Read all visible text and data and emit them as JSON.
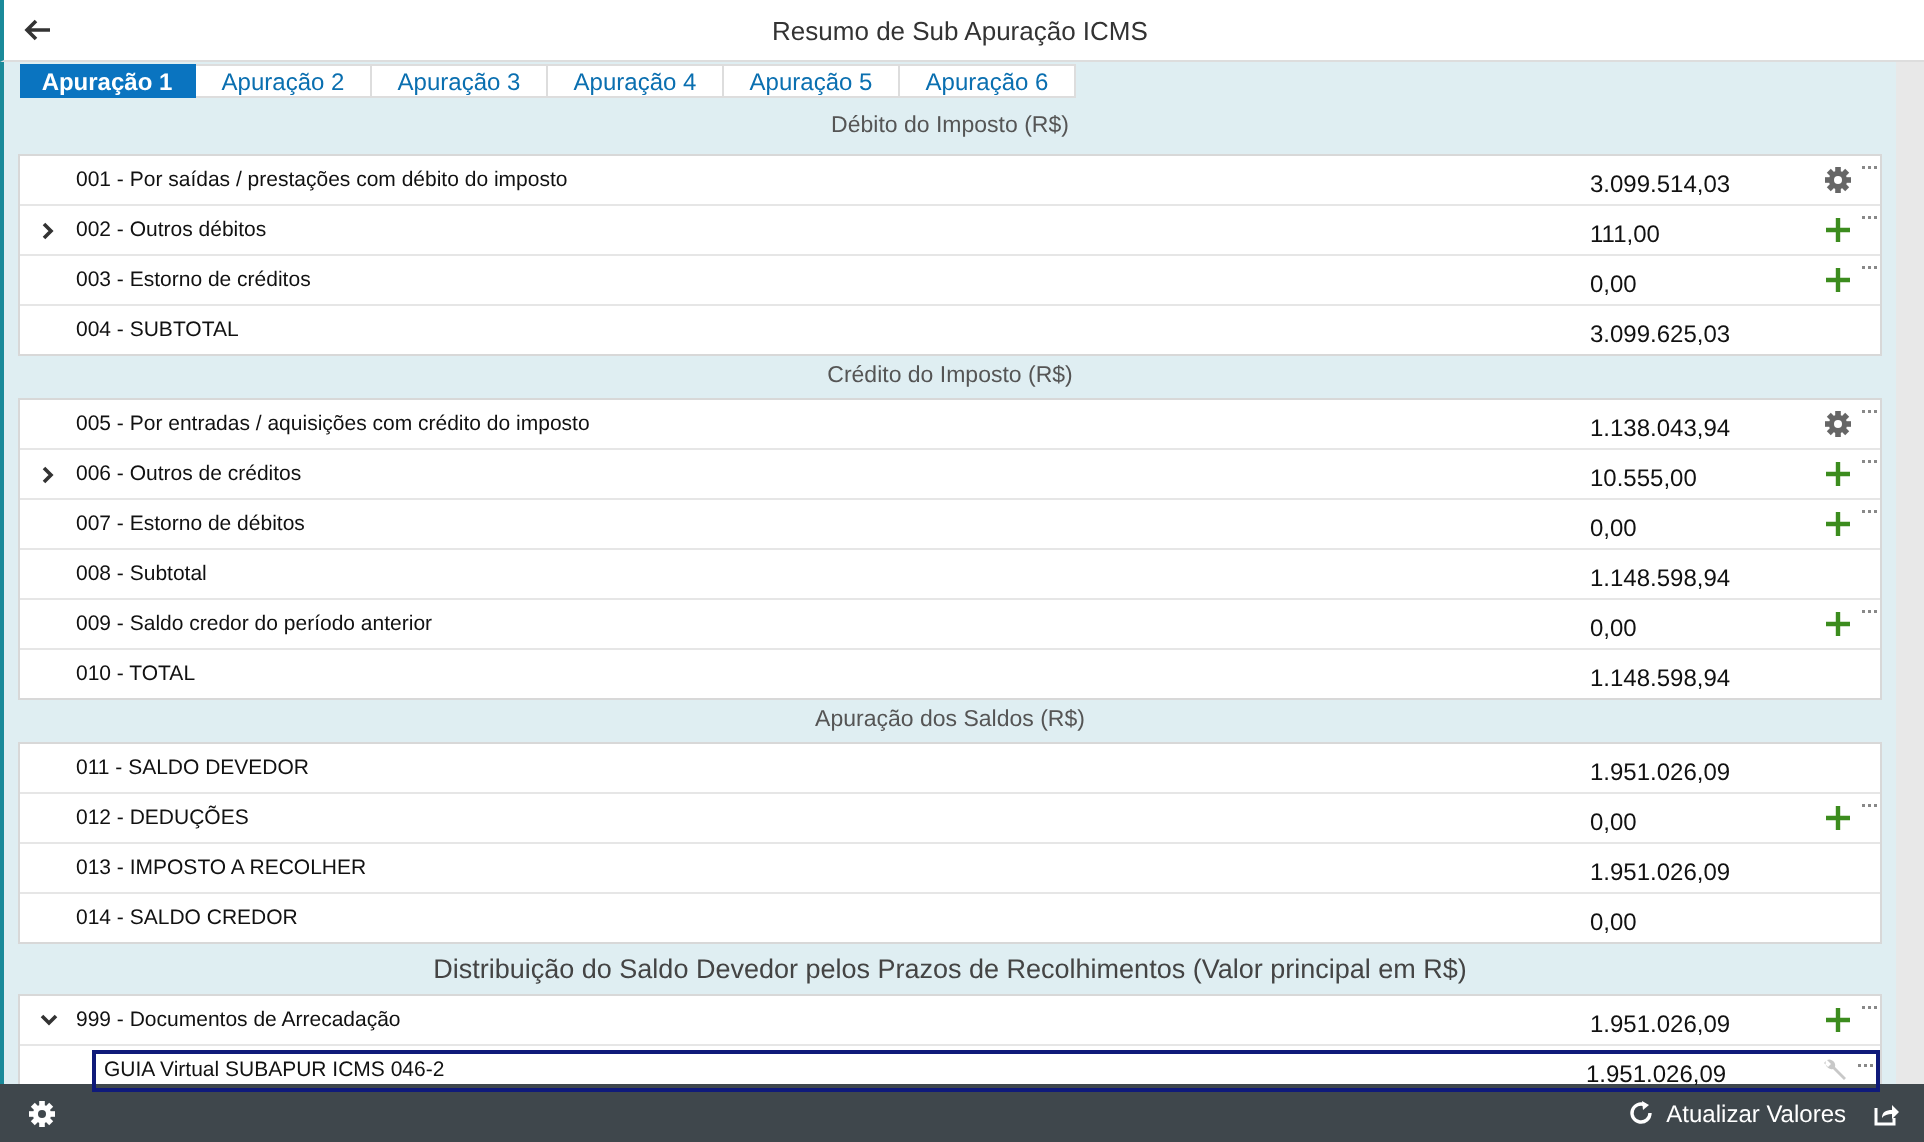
{
  "window": {
    "title": "Resumo de Sub Apuração ICMS"
  },
  "tabs": [
    {
      "label": "Apuração 1",
      "selected": true
    },
    {
      "label": "Apuração 2",
      "selected": false
    },
    {
      "label": "Apuração 3",
      "selected": false
    },
    {
      "label": "Apuração 4",
      "selected": false
    },
    {
      "label": "Apuração 5",
      "selected": false
    },
    {
      "label": "Apuração 6",
      "selected": false
    }
  ],
  "sections": [
    {
      "title": "Débito do Imposto (R$)",
      "kind": "minor",
      "rows": [
        {
          "label": "001 - Por saídas / prestações com débito do imposto",
          "value": "3.099.514,03",
          "kind": "settings"
        },
        {
          "label": "002 - Outros débitos",
          "value": "111,00",
          "kind": "add",
          "expanded": false
        },
        {
          "label": "003 - Estorno de créditos",
          "value": "0,00",
          "kind": "add"
        },
        {
          "label": "004 - SUBTOTAL",
          "value": "3.099.625,03",
          "kind": "plain"
        }
      ]
    },
    {
      "title": "Crédito do Imposto (R$)",
      "kind": "minor",
      "rows": [
        {
          "label": "005 - Por entradas / aquisições com crédito do imposto",
          "value": "1.138.043,94",
          "kind": "settings"
        },
        {
          "label": "006 - Outros de créditos",
          "value": "10.555,00",
          "kind": "add",
          "expanded": false
        },
        {
          "label": "007 - Estorno de débitos",
          "value": "0,00",
          "kind": "add"
        },
        {
          "label": "008 - Subtotal",
          "value": "1.148.598,94",
          "kind": "plain"
        },
        {
          "label": "009 - Saldo credor do período anterior",
          "value": "0,00",
          "kind": "add"
        },
        {
          "label": "010 - TOTAL",
          "value": "1.148.598,94",
          "kind": "plain"
        }
      ]
    },
    {
      "title": "Apuração dos Saldos (R$)",
      "kind": "minor",
      "rows": [
        {
          "label": "011 - SALDO DEVEDOR",
          "value": "1.951.026,09",
          "kind": "plain"
        },
        {
          "label": "012 - DEDUÇÕES",
          "value": "0,00",
          "kind": "add"
        },
        {
          "label": "013 - IMPOSTO A RECOLHER",
          "value": "1.951.026,09",
          "kind": "plain"
        },
        {
          "label": "014 - SALDO CREDOR",
          "value": "0,00",
          "kind": "plain"
        }
      ]
    },
    {
      "title": "Distribuição do Saldo Devedor pelos Prazos de Recolhimentos (Valor principal em R$)",
      "kind": "major",
      "rows": [
        {
          "label": "999 - Documentos de Arrecadação",
          "value": "1.951.026,09",
          "kind": "add",
          "expanded": true,
          "children": [
            {
              "label": "GUIA Virtual SUBAPUR ICMS 046-2",
              "value": "1.951.026,09",
              "kind": "tool",
              "selected": true
            }
          ]
        }
      ]
    }
  ],
  "footer": {
    "refresh_button": "Atualizar Valores"
  }
}
